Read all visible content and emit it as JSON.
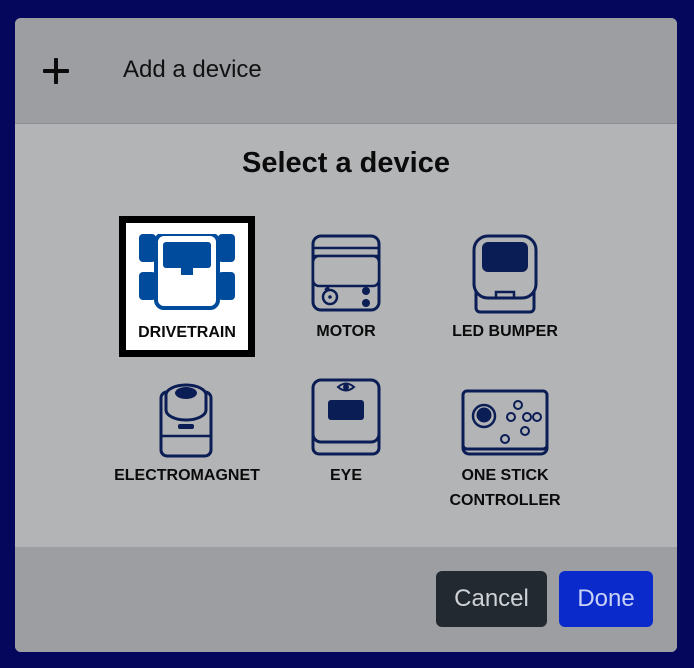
{
  "header": {
    "icon": "plus-icon",
    "title": "Add a device"
  },
  "body": {
    "title": "Select a device",
    "devices": [
      {
        "label": "DRIVETRAIN",
        "icon": "drivetrain-icon",
        "selected": true
      },
      {
        "label": "MOTOR",
        "icon": "motor-icon",
        "selected": false
      },
      {
        "label": "LED BUMPER",
        "icon": "led-bumper-icon",
        "selected": false
      },
      {
        "label": "ELECTROMAGNET",
        "icon": "electromagnet-icon",
        "selected": false
      },
      {
        "label": "EYE",
        "icon": "eye-sensor-icon",
        "selected": false
      },
      {
        "label": "ONE STICK",
        "label_line2": "CONTROLLER",
        "icon": "controller-icon",
        "selected": false
      }
    ]
  },
  "footer": {
    "cancel_label": "Cancel",
    "done_label": "Done"
  },
  "colors": {
    "background": "#05075c",
    "header": "#9c9ea2",
    "body": "#b3b4b6",
    "icon_navy": "#0b1d55",
    "icon_blue": "#004b9b",
    "cancel": "#222930",
    "done": "#0a2acb"
  }
}
